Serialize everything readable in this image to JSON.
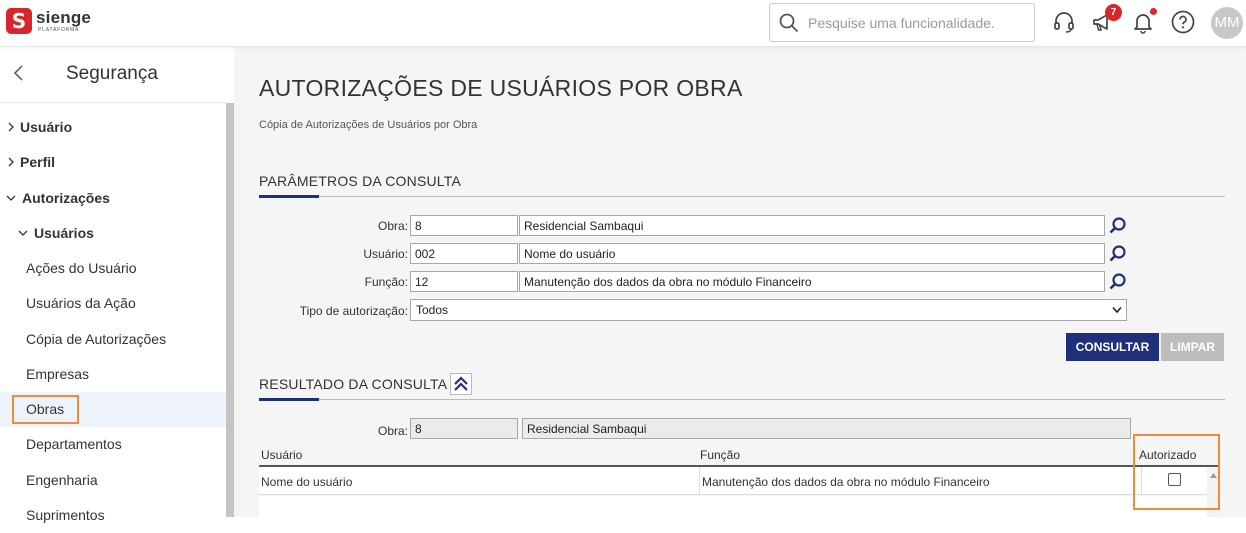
{
  "brand": {
    "name": "sienge",
    "sub": "PLATAFORMA",
    "mark": "S"
  },
  "topbar": {
    "search_placeholder": "Pesquise uma funcionalidade.",
    "notifications_badge": "7",
    "avatar_initials": "MM"
  },
  "sidebar": {
    "title": "Segurança",
    "items": [
      {
        "label": "Usuário"
      },
      {
        "label": "Perfil"
      },
      {
        "label": "Autorizações"
      },
      {
        "label": "Usuários"
      },
      {
        "label": "Ações do Usuário"
      },
      {
        "label": "Usuários da Ação"
      },
      {
        "label": "Cópia de Autorizações"
      },
      {
        "label": "Empresas"
      },
      {
        "label": "Obras"
      },
      {
        "label": "Departamentos"
      },
      {
        "label": "Engenharia"
      },
      {
        "label": "Suprimentos"
      }
    ]
  },
  "page": {
    "title": "AUTORIZAÇÕES DE USUÁRIOS POR OBRA",
    "subtitle": "Cópia de Autorizações de Usuários por Obra"
  },
  "params": {
    "section_title": "PARÂMETROS DA CONSULTA",
    "obra": {
      "label": "Obra:",
      "code": "8",
      "desc": "Residencial Sambaqui"
    },
    "usuario": {
      "label": "Usuário:",
      "code": "002",
      "desc": "Nome do usuário"
    },
    "funcao": {
      "label": "Função:",
      "code": "12",
      "desc": "Manutenção dos dados da obra no módulo Financeiro"
    },
    "tipo": {
      "label": "Tipo de autorização:",
      "value": "Todos"
    },
    "consultar_label": "CONSULTAR",
    "limpar_label": "LIMPAR"
  },
  "result": {
    "section_title": "RESULTADO DA CONSULTA",
    "obra_label": "Obra:",
    "obra_code": "8",
    "obra_desc": "Residencial Sambaqui",
    "columns": {
      "usuario": "Usuário",
      "funcao": "Função",
      "autorizado": "Autorizado"
    },
    "rows": [
      {
        "usuario": "Nome do usuário",
        "funcao": "Manutenção dos dados da obra no módulo Financeiro",
        "autorizado": false
      }
    ]
  },
  "colors": {
    "accent": "#1f2f7a",
    "brand": "#d9262c",
    "highlight": "#f08a3c"
  }
}
